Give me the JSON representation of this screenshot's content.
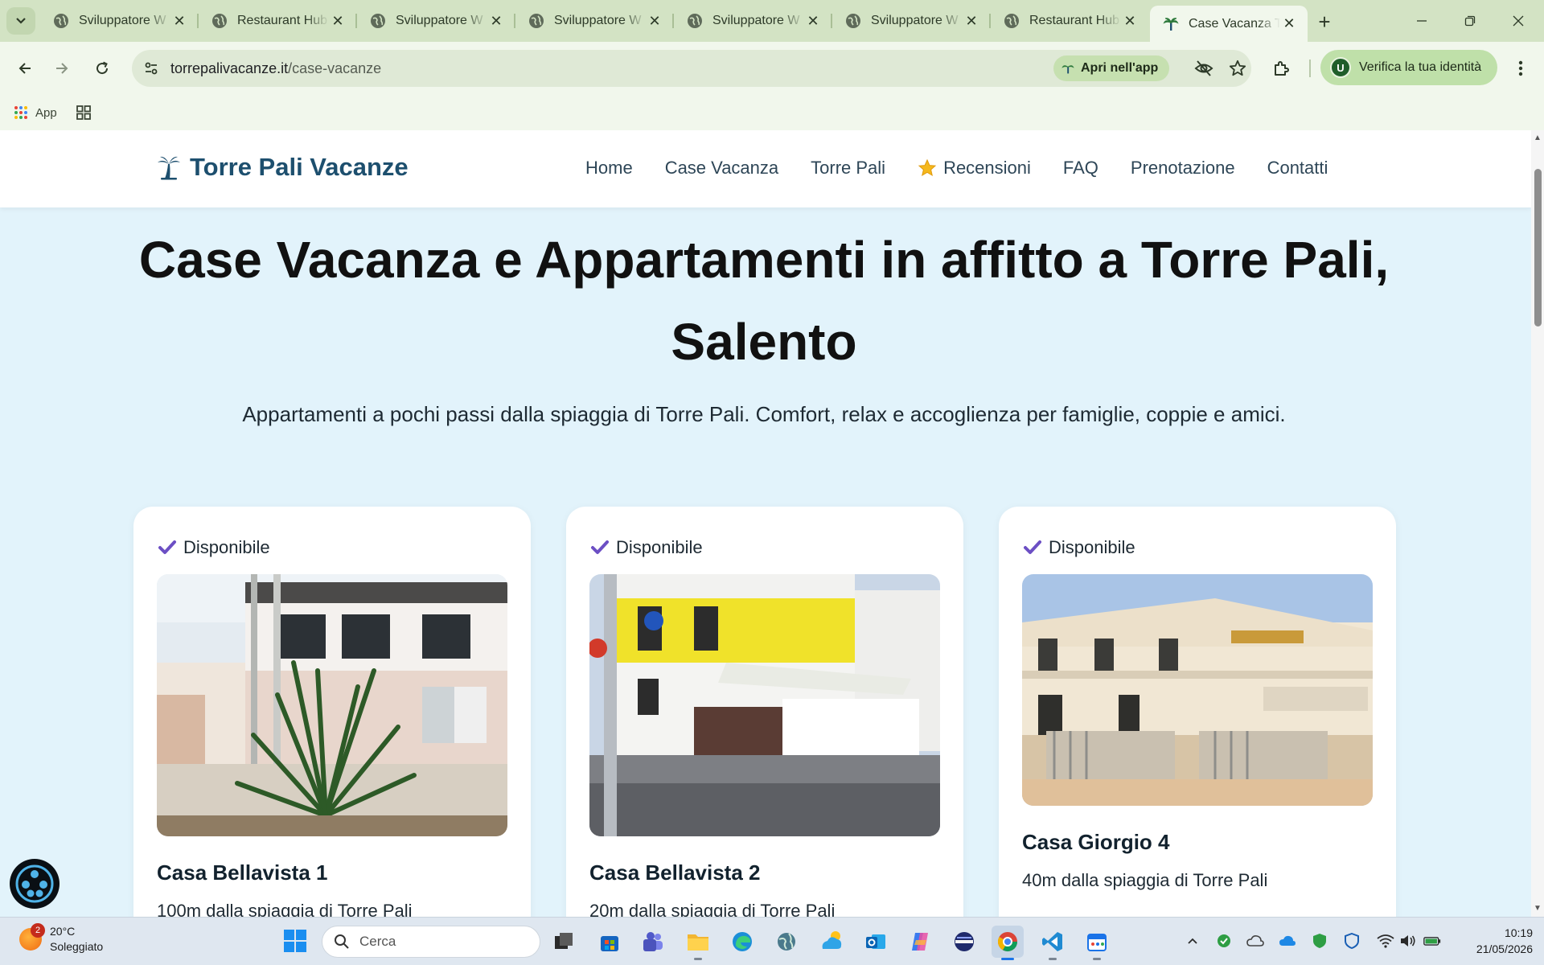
{
  "browser": {
    "tabs": [
      {
        "title": "Sviluppatore W",
        "favicon": "globe-icon"
      },
      {
        "title": "Restaurant Hub",
        "favicon": "globe-icon"
      },
      {
        "title": "Sviluppatore W",
        "favicon": "globe-icon"
      },
      {
        "title": "Sviluppatore W",
        "favicon": "globe-icon"
      },
      {
        "title": "Sviluppatore W",
        "favicon": "globe-icon"
      },
      {
        "title": "Sviluppatore W",
        "favicon": "globe-icon"
      },
      {
        "title": "Restaurant Hub",
        "favicon": "globe-icon"
      },
      {
        "title": "Case Vacanza To",
        "favicon": "palm-icon",
        "active": true
      }
    ],
    "address": {
      "domain": "torrepalivacanze.it",
      "path": "/case-vacanze"
    },
    "open_in_app": "Apri nell'app",
    "profile_label": "Verifica la tua identità",
    "profile_initial": "U",
    "bookmarks": {
      "apps": "App"
    },
    "colors": {
      "tabstrip": "#d3e3c4",
      "toolbar": "#f1f7ec",
      "omnibox": "#dfe9d6"
    }
  },
  "site": {
    "logo": "Torre Pali Vacanze",
    "nav": [
      "Home",
      "Case Vacanza",
      "Torre Pali",
      "Recensioni",
      "FAQ",
      "Prenotazione",
      "Contatti"
    ],
    "hero_title": "Case Vacanza e Appartamenti in affitto a Torre Pali, Salento",
    "hero_subtitle": "Appartamenti a pochi passi dalla spiaggia di Torre Pali. Comfort, relax e accoglienza per famiglie, coppie e amici.",
    "cards": [
      {
        "status": "Disponibile",
        "name": "Casa Bellavista 1",
        "distance": "100m dalla spiaggia di Torre Pali"
      },
      {
        "status": "Disponibile",
        "name": "Casa Bellavista 2",
        "distance": "20m dalla spiaggia di Torre Pali"
      },
      {
        "status": "Disponibile",
        "name": "Casa Giorgio 4",
        "distance": "40m dalla spiaggia di Torre Pali"
      }
    ],
    "colors": {
      "background": "#e2f3fb",
      "brand": "#1d4f6e",
      "check": "#6c4fc4",
      "button": "#1f9a4a"
    }
  },
  "taskbar": {
    "weather_temp": "20°C",
    "weather_desc": "Soleggiato",
    "weather_badge": "2",
    "search_placeholder": "Cerca",
    "time": "10:19",
    "date": "21/05/2026"
  }
}
